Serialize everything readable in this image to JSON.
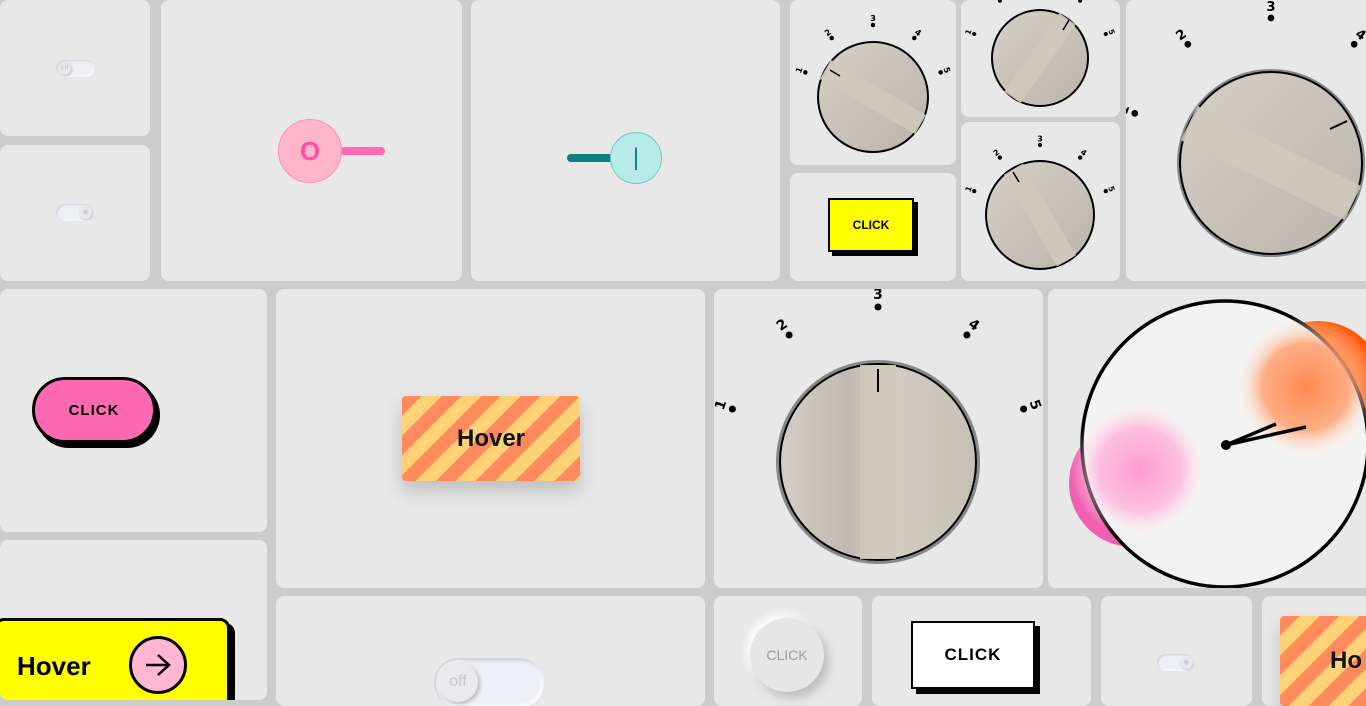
{
  "toggles": {
    "off_label": "off"
  },
  "buttons": {
    "click_label": "CLICK",
    "click_label_lower": "CLICK",
    "hover_label": "Hover",
    "hover_partial": "Ho"
  },
  "switches": {
    "pink_symbol": "O",
    "teal_symbol": "|"
  },
  "dial": {
    "numbers": [
      "1",
      "2",
      "3",
      "4",
      "5"
    ]
  },
  "colors": {
    "pink": "#ff69b4",
    "yellow": "#ffff00",
    "teal": "#0f8080",
    "teal_light": "#b7ebe8",
    "orange": "#ff5500",
    "knob_beige": "#cdc8bd"
  }
}
